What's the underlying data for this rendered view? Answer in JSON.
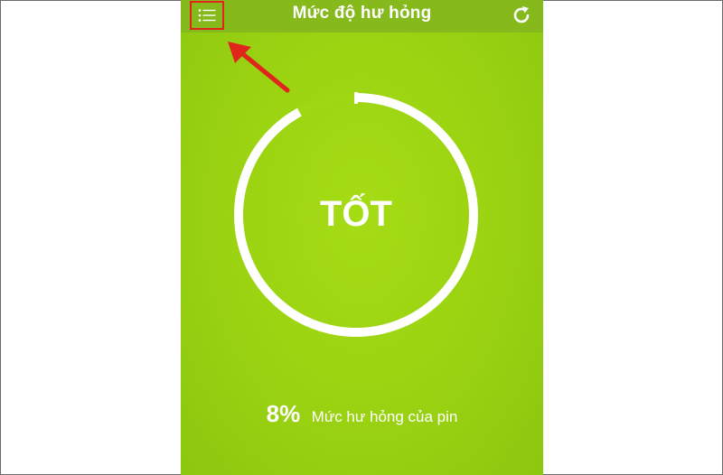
{
  "header": {
    "title": "Mức độ hư hỏng",
    "menu_icon": "list-icon",
    "refresh_icon": "refresh-icon"
  },
  "gauge": {
    "status": "TỐT",
    "wear_fraction": 0.08
  },
  "footer": {
    "percent": "8%",
    "caption": "Mức hư hỏng của pin"
  },
  "colors": {
    "background": "#9ad212",
    "topbar": "#86b91c",
    "ring": "#ffffff",
    "highlight": "#e0261c"
  }
}
